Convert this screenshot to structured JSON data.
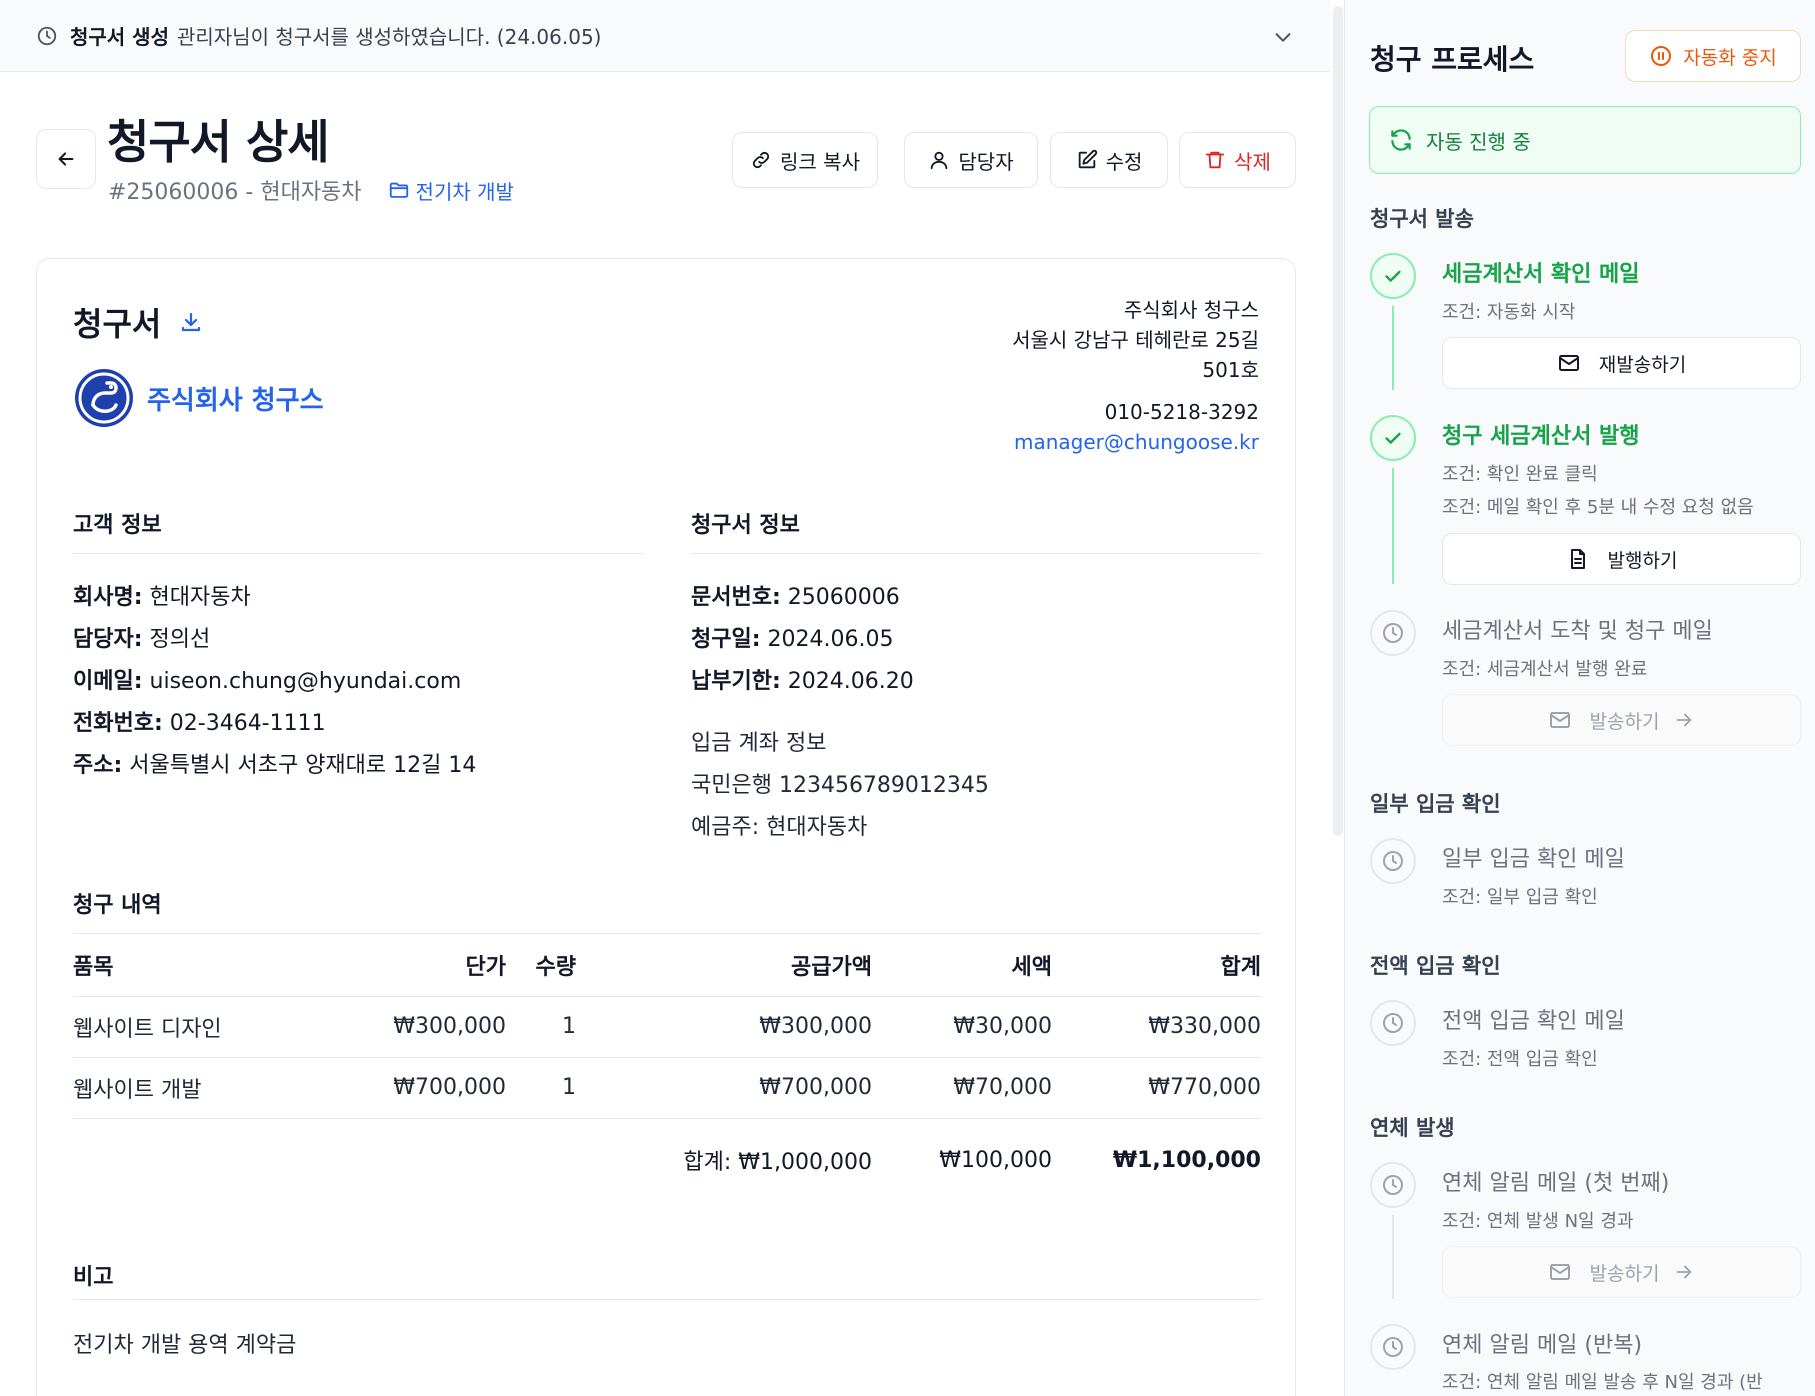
{
  "notice": {
    "title": "청구서 생성",
    "message": "관리자님이 청구서를 생성하였습니다. (24.06.05)"
  },
  "header": {
    "title": "청구서 상세",
    "subtitle": "#25060006 - 현대자동차",
    "project": "전기차 개발"
  },
  "actions": {
    "copy_link": "링크 복사",
    "assignee": "담당자",
    "edit": "수정",
    "delete": "삭제"
  },
  "invoice": {
    "title": "청구서",
    "company_name": "주식회사 청구스",
    "sender": {
      "name": "주식회사 청구스",
      "address_line1": "서울시 강남구 테헤란로 25길",
      "address_line2": "501호",
      "phone": "010-5218-3292",
      "email": "manager@chungoose.kr"
    },
    "customer": {
      "section_title": "고객 정보",
      "company_label": "회사명:",
      "company": "현대자동차",
      "contact_label": "담당자:",
      "contact": "정의선",
      "email_label": "이메일:",
      "email": "uiseon.chung@hyundai.com",
      "phone_label": "전화번호:",
      "phone": "02-3464-1111",
      "address_label": "주소:",
      "address": "서울특별시 서초구 양재대로 12길 14"
    },
    "info": {
      "section_title": "청구서 정보",
      "doc_no_label": "문서번호:",
      "doc_no": "25060006",
      "date_label": "청구일:",
      "date": "2024.06.05",
      "due_label": "납부기한:",
      "due": "2024.06.20",
      "bank_title": "입금 계좌 정보",
      "bank_account": "국민은행 123456789012345",
      "account_holder": "예금주: 현대자동차"
    },
    "items": {
      "section_title": "청구 내역",
      "headers": [
        "품목",
        "단가",
        "수량",
        "공급가액",
        "세액",
        "합계"
      ],
      "rows": [
        [
          "웹사이트 디자인",
          "₩300,000",
          "1",
          "₩300,000",
          "₩30,000",
          "₩330,000"
        ],
        [
          "웹사이트 개발",
          "₩700,000",
          "1",
          "₩700,000",
          "₩70,000",
          "₩770,000"
        ]
      ],
      "total_supply": "합계: ₩1,000,000",
      "total_tax": "₩100,000",
      "total_amount": "₩1,100,000"
    },
    "notes": {
      "section_title": "비고",
      "text": "전기차 개발 용역 계약금"
    }
  },
  "process": {
    "title": "청구 프로세스",
    "pause_label": "자동화 중지",
    "status": "자동 진행 중",
    "groups": [
      {
        "title": "청구서 발송",
        "steps": [
          {
            "title": "세금계산서 확인 메일",
            "conditions": [
              "조건: 자동화 시작"
            ],
            "button": "재발송하기",
            "state": "done"
          },
          {
            "title": "청구 세금계산서 발행",
            "conditions": [
              "조건: 확인 완료 클릭",
              "조건: 메일 확인 후 5분 내 수정 요청 없음"
            ],
            "button": "발행하기",
            "state": "done"
          },
          {
            "title": "세금계산서 도착 및 청구 메일",
            "conditions": [
              "조건: 세금계산서 발행 완료"
            ],
            "button": "발송하기",
            "state": "pending"
          }
        ]
      },
      {
        "title": "일부 입금 확인",
        "steps": [
          {
            "title": "일부 입금 확인 메일",
            "conditions": [
              "조건: 일부 입금 확인"
            ],
            "state": "pending"
          }
        ]
      },
      {
        "title": "전액 입금 확인",
        "steps": [
          {
            "title": "전액 입금 확인 메일",
            "conditions": [
              "조건: 전액 입금 확인"
            ],
            "state": "pending"
          }
        ]
      },
      {
        "title": "연체 발생",
        "steps": [
          {
            "title": "연체 알림 메일 (첫 번째)",
            "conditions": [
              "조건: 연체 발생 N일 경과"
            ],
            "button": "발송하기",
            "state": "pending"
          },
          {
            "title": "연체 알림 메일 (반복)",
            "conditions": [
              "조건: 연체 알림 메일 발송 후 N일 경과 (반"
            ],
            "state": "pending"
          }
        ]
      }
    ]
  },
  "colors": {
    "accent": "#2563eb",
    "success": "#16a34a",
    "danger": "#dc2626",
    "warning": "#ea580c"
  },
  "icons": [
    "clock-icon",
    "chevron-down-icon",
    "arrow-left-icon",
    "link-icon",
    "user-icon",
    "edit-icon",
    "trash-icon",
    "folder-icon",
    "download-icon",
    "goose-logo-icon",
    "pause-icon",
    "refresh-icon",
    "check-icon",
    "mail-icon",
    "document-icon",
    "arrow-right-icon"
  ]
}
